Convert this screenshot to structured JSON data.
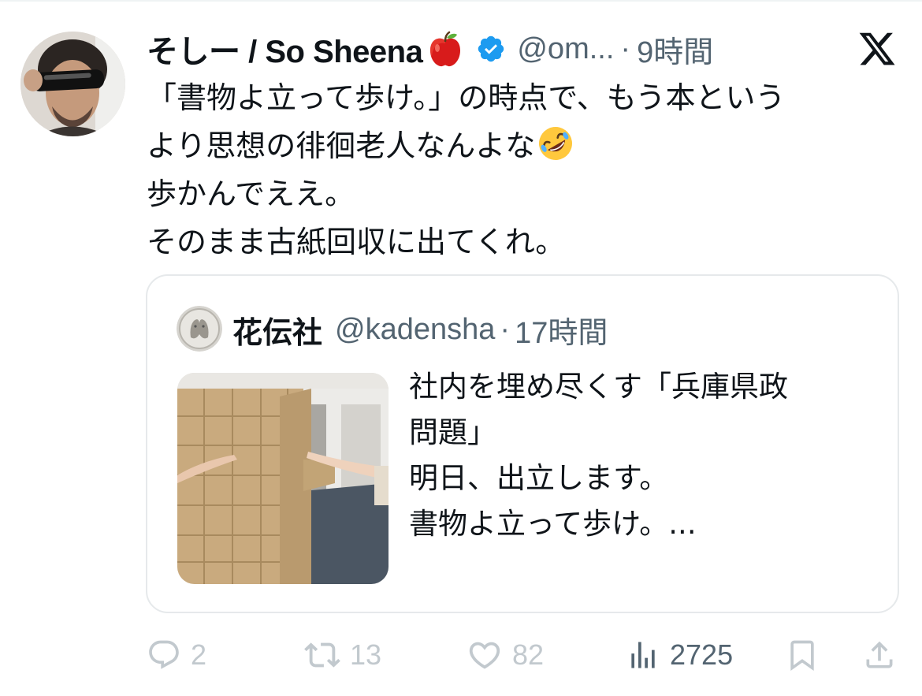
{
  "author": {
    "display_name": "そしー / So Sheena",
    "handle": "@om...",
    "separator": "·",
    "time": "9時間",
    "badge_icons": [
      "apple-emoji-icon",
      "verified-badge-icon"
    ]
  },
  "tweet": {
    "lines": [
      "「書物よ立って歩け。」の時点で、もう本という",
      "より思想の徘徊老人なんよな",
      "歩かんでええ。",
      "そのまま古紙回収に出てくれ。"
    ],
    "emoji": "rolling-on-floor-laughing-emoji"
  },
  "quote": {
    "name": "花伝社",
    "handle": "@kadensha",
    "separator": "·",
    "time": "17時間",
    "lines": [
      "社内を埋め尽くす「兵庫県政",
      "問題」",
      "明日、出立します。",
      "書物よ立って歩け。..."
    ]
  },
  "actions": {
    "replies": "2",
    "retweets": "13",
    "likes": "82",
    "views": "2725"
  },
  "colors": {
    "text": "#0f1419",
    "secondary": "#536471",
    "muted_action": "#c2c9ce",
    "verified": "#1d9bf0",
    "border": "#e6e9eb"
  },
  "icons": {
    "brand": "x-logo-icon",
    "reply": "reply-icon",
    "retweet": "retweet-icon",
    "like": "heart-icon",
    "views": "views-chart-icon",
    "bookmark": "bookmark-icon",
    "share": "share-icon"
  }
}
